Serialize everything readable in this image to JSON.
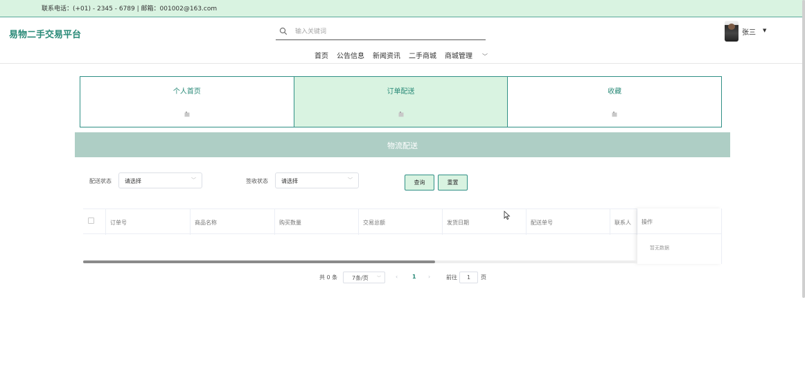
{
  "topbar": {
    "contact": "联系电话：(+01) - 2345 - 6789 | 邮箱：001002@163.com"
  },
  "header": {
    "site_title": "易物二手交易平台",
    "search_placeholder": "输入关键词",
    "nav": [
      "首页",
      "公告信息",
      "新闻资讯",
      "二手商城",
      "商城管理"
    ],
    "username": "张三"
  },
  "tabs": [
    {
      "label": "个人首页",
      "active": false
    },
    {
      "label": "订单配送",
      "active": true
    },
    {
      "label": "收藏",
      "active": false
    }
  ],
  "banner": {
    "title": "物流配送"
  },
  "filters": {
    "delivery_status_label": "配送状态",
    "delivery_status_value": "请选择",
    "receipt_status_label": "签收状态",
    "receipt_status_value": "请选择",
    "query_button": "查询",
    "reset_button": "重置"
  },
  "table": {
    "columns": [
      "订单号",
      "商品名称",
      "购买数量",
      "交易总额",
      "发货日期",
      "配送单号",
      "联系人"
    ],
    "operation_column": "操作",
    "empty_text": "暂无数据",
    "scroll_fraction": 0.635
  },
  "pagination": {
    "total": "共 0 条",
    "page_size": "7条/页",
    "current_page": "1",
    "goto_prefix": "前往",
    "goto_value": "1",
    "goto_suffix": "页"
  },
  "colors": {
    "accent": "#2a8a78",
    "light_green": "#d9f3e1",
    "banner": "#aecec5"
  }
}
